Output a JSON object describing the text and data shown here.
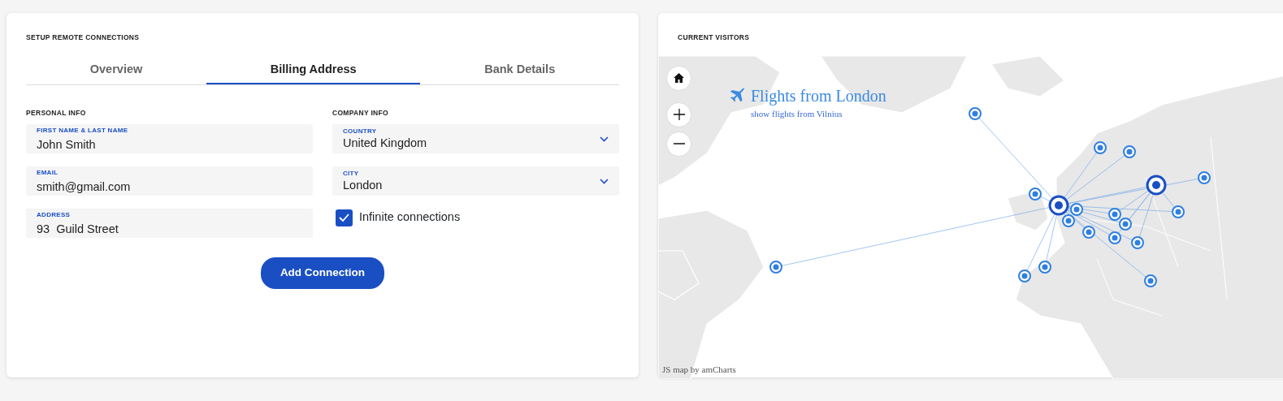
{
  "left_panel": {
    "title": "SETUP REMOTE CONNECTIONS",
    "tabs": [
      {
        "label": "Overview",
        "selected": false
      },
      {
        "label": "Billing Address",
        "selected": true
      },
      {
        "label": "Bank Details",
        "selected": false
      }
    ],
    "personal_info": {
      "heading": "PERSONAL INFO",
      "fields": [
        {
          "label": "FIRST NAME & LAST NAME",
          "value": "John Smith"
        },
        {
          "label": "EMAIL",
          "value": "smith@gmail.com"
        },
        {
          "label": "ADDRESS",
          "value": "93  Guild Street"
        }
      ]
    },
    "company_info": {
      "heading": "COMPANY INFO",
      "selects": [
        {
          "label": "COUNTRY",
          "value": "United Kingdom"
        },
        {
          "label": "CITY",
          "value": "London"
        }
      ],
      "checkbox": {
        "label": "Infinite connections",
        "checked": true
      }
    },
    "button": "Add Connection"
  },
  "right_panel": {
    "title": "CURRENT VISITORS",
    "map": {
      "title": "Flights from London",
      "link": "show flights from Vilnius",
      "credit": "JS map by amCharts"
    }
  }
}
